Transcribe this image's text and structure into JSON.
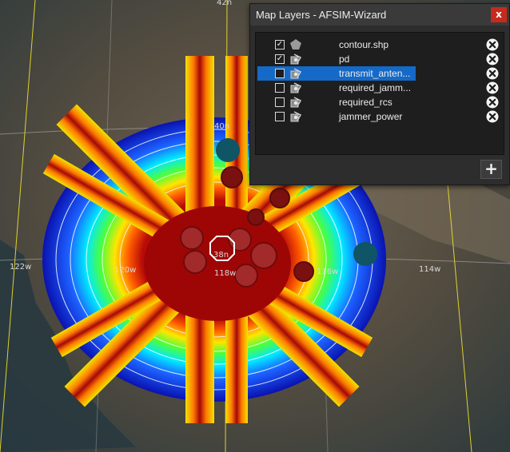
{
  "map": {
    "lat_labels": [
      "42n",
      "40n",
      "38n"
    ],
    "lon_labels": [
      "122w",
      "120w",
      "118w",
      "116w",
      "114w"
    ],
    "colors": {
      "core": "#a60808",
      "outer": "#1a1fc0",
      "beam": "#e8d400",
      "marker": "#0f5566",
      "grid": "#f0e030"
    }
  },
  "panel": {
    "title": "Map Layers - AFSIM-Wizard",
    "close_label": "x",
    "add_label": "+",
    "layers": [
      {
        "name": "contour.shp",
        "checked": true,
        "icon": "shape-icon",
        "selected": false
      },
      {
        "name": "pd",
        "checked": true,
        "icon": "raster-icon",
        "selected": false
      },
      {
        "name": "transmit_anten...",
        "checked": false,
        "icon": "raster-icon",
        "selected": true
      },
      {
        "name": "required_jamm...",
        "checked": false,
        "icon": "raster-icon",
        "selected": false
      },
      {
        "name": "required_rcs",
        "checked": false,
        "icon": "raster-icon",
        "selected": false
      },
      {
        "name": "jammer_power",
        "checked": false,
        "icon": "raster-icon",
        "selected": false
      }
    ]
  }
}
